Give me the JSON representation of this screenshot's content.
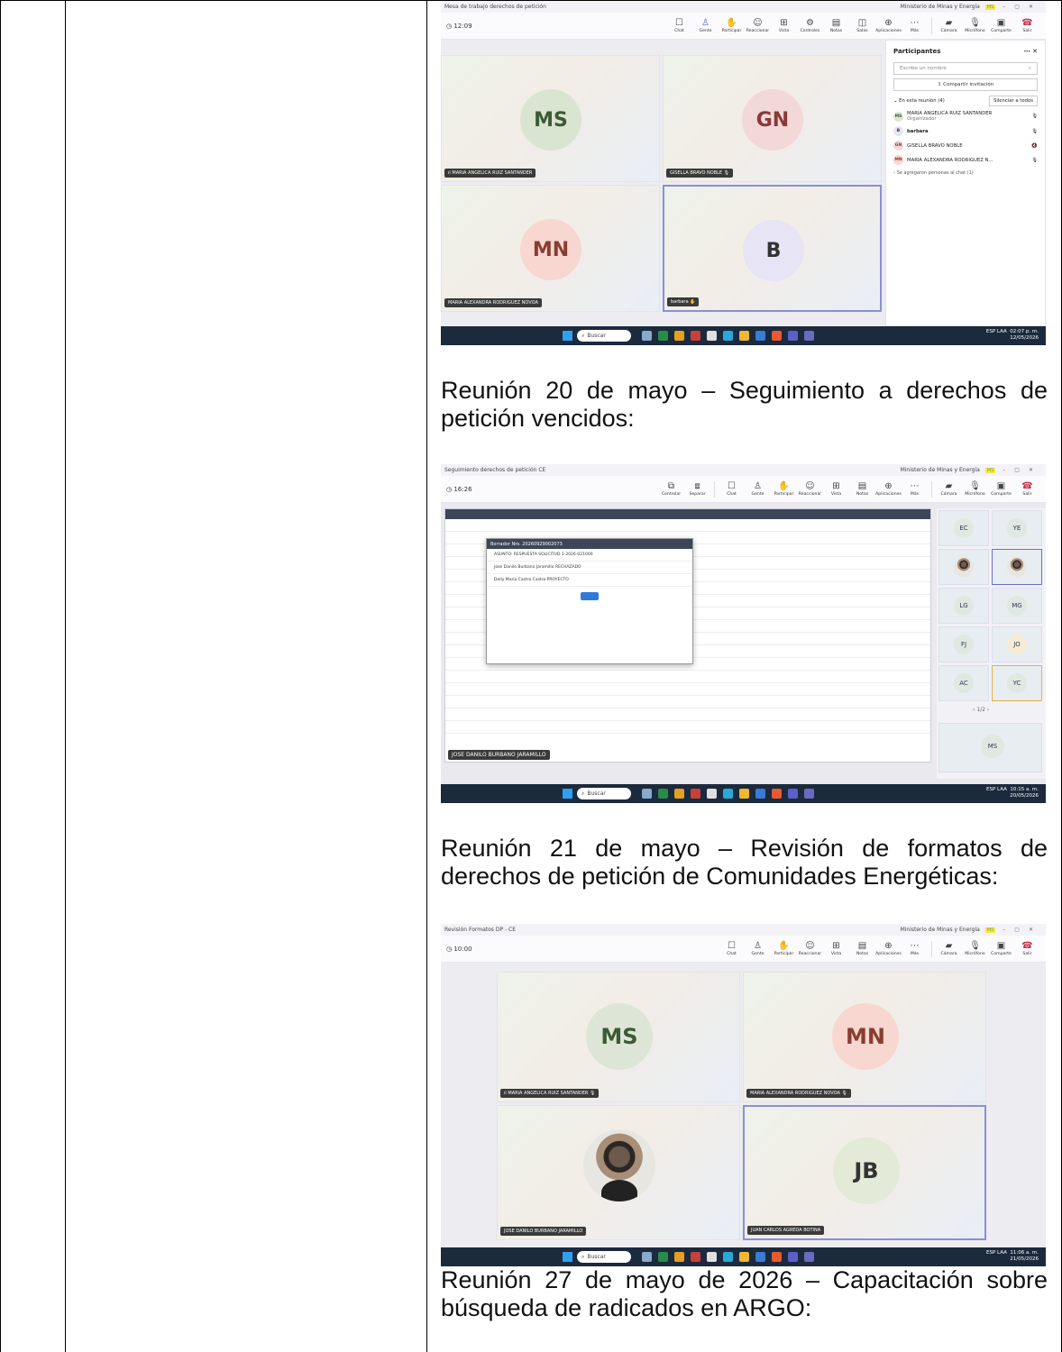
{
  "shot1": {
    "window_title": "Mesa de trabajo derechos de petición",
    "org": "Ministerio de Minas y Energía",
    "user_badge": "MS",
    "timer": "12:09",
    "controls": [
      "Chat",
      "Gente",
      "Participar",
      "Reaccionar",
      "Vista",
      "Controles",
      "Notas",
      "Salas",
      "Aplicaciones",
      "Más",
      "Cámara",
      "Micrófono",
      "Comparte",
      "Salir"
    ],
    "tiles": [
      {
        "initials": "MS",
        "name": "MARIA ANGELICA RUIZ SANTANDER"
      },
      {
        "initials": "GN",
        "name": "GISELLA BRAVO NOBLE"
      },
      {
        "initials": "MN",
        "name": "MARIA ALEXANDRA RODRIGUEZ NOVOA"
      },
      {
        "initials": "B",
        "name": "barbara"
      }
    ],
    "panel": {
      "title": "Participantes",
      "search_placeholder": "Escribe un nombre",
      "share_label": "Compartir invitación",
      "section_label": "En esta reunión (4)",
      "mute_all": "Silenciar a todos",
      "participants": [
        {
          "initials": "MS",
          "name": "MARIA ANGELICA RUIZ SANTANDER",
          "role": "Organizador"
        },
        {
          "initials": "B",
          "name": "barbara",
          "role": ""
        },
        {
          "initials": "GN",
          "name": "GISELLA BRAVO NOBLE",
          "role": ""
        },
        {
          "initials": "MN",
          "name": "MARIA ALEXANDRA RODRIGUEZ N...",
          "role": ""
        }
      ],
      "chat_note": "Se agregaron personas al chat (1)"
    },
    "taskbar": {
      "search": "Buscar",
      "lang": "ESP LAA",
      "time": "02:07 p. m.",
      "date": "12/05/2026"
    }
  },
  "caption1": "Reunión 20 de mayo – Seguimiento a derechos de petición vencidos:",
  "shot2": {
    "window_title": "Seguimiento derechos de petición CE",
    "org": "Ministerio de Minas y Energía",
    "user_badge": "MS",
    "timer": "16:26",
    "controls": [
      "Controlar",
      "Separar",
      "Chat",
      "Gente",
      "Participar",
      "Reaccionar",
      "Vista",
      "Notas",
      "Aplicaciones",
      "Más",
      "Cámara",
      "Micrófono",
      "Comparte",
      "Salir"
    ],
    "dialog_title": "Borrador Nro. 20260929002073",
    "dialog_subject": "RESPUESTA SOLICITUD 1-2026-021000",
    "dialog_rows": [
      "Jose Danilo Burbano Jaramillo RECHAZADO",
      "Dolly Maria Castro Castro PROYECTO"
    ],
    "gallery": [
      "EC",
      "YE",
      "LG",
      "MG",
      "FJ",
      "JO",
      "AC",
      "YC",
      "MS"
    ],
    "page_indicator": "1/2",
    "presenter": "JOSE DANILO BURBANO JARAMILLO",
    "taskbar": {
      "search": "Buscar",
      "lang": "ESP LAA",
      "time": "10:15 a. m.",
      "date": "20/05/2026"
    }
  },
  "caption2": "Reunión 21 de mayo – Revisión de formatos de derechos de petición de Comunidades Energéticas:",
  "shot3": {
    "window_title": "Revisión Formatos DP - CE",
    "org": "Ministerio de Minas y Energía",
    "user_badge": "MS",
    "timer": "10:00",
    "controls": [
      "Chat",
      "Gente",
      "Participar",
      "Reaccionar",
      "Vista",
      "Notas",
      "Aplicaciones",
      "Más",
      "Cámara",
      "Micrófono",
      "Comparte",
      "Salir"
    ],
    "tiles": [
      {
        "initials": "MS",
        "name": "MARIA ANGELICA RUIZ SANTANDER"
      },
      {
        "initials": "MN",
        "name": "MARIA ALEXANDRA RODRIGUEZ NOVOA"
      },
      {
        "initials": "",
        "name": "JOSE DANILO BURBANO JARAMILLO"
      },
      {
        "initials": "JB",
        "name": "JUAN CARLOS AGREDA BOTINA"
      }
    ],
    "taskbar": {
      "search": "Buscar",
      "lang": "ESP LAA",
      "time": "11:06 a. m.",
      "date": "21/05/2026"
    }
  },
  "caption3": "Reunión 27 de mayo de 2026 – Capacitación sobre búsqueda de radicados en ARGO:"
}
